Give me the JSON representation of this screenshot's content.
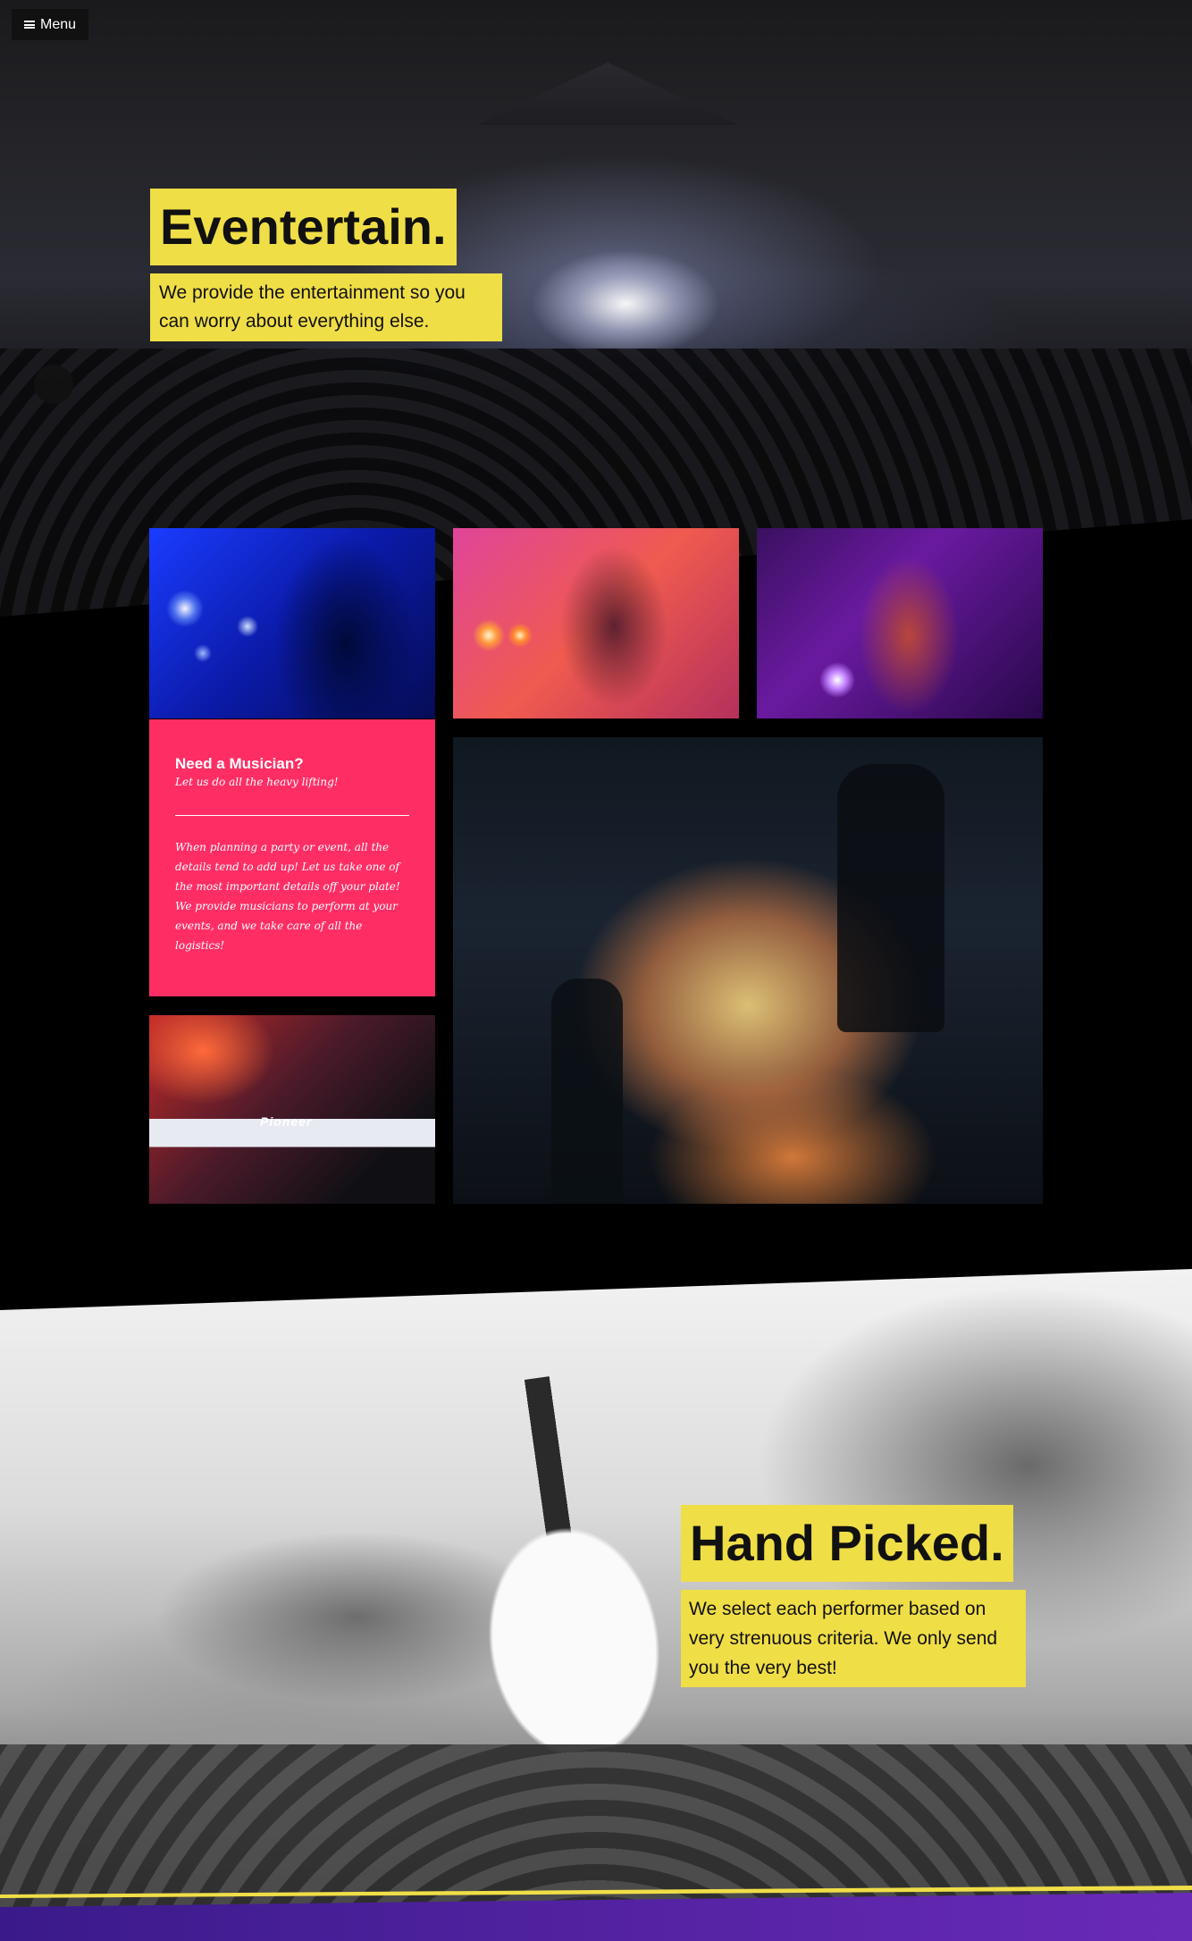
{
  "menu": {
    "label": "Menu",
    "icon": "hamburger-icon"
  },
  "hero": {
    "title": "Eventertain.",
    "subtitle": "We provide the entertainment so you can worry about everything else."
  },
  "musician_card": {
    "heading": "Need a Musician?",
    "tagline": "Let us do all the heavy lifting!",
    "body": "When planning a party or event, all the details tend to add up! Let us take one of the most important details off your plate! We provide musicians to perform at your events, and we take care of all the logistics!"
  },
  "gallery": {
    "dj_brand": "Pioneer"
  },
  "hand_picked": {
    "title": "Hand Picked.",
    "subtitle": "We select each performer based on very strenuous criteria. We only send you the very best!"
  },
  "colors": {
    "accent_yellow": "#f0de47",
    "accent_pink": "#fe2e65",
    "background": "#000000"
  }
}
